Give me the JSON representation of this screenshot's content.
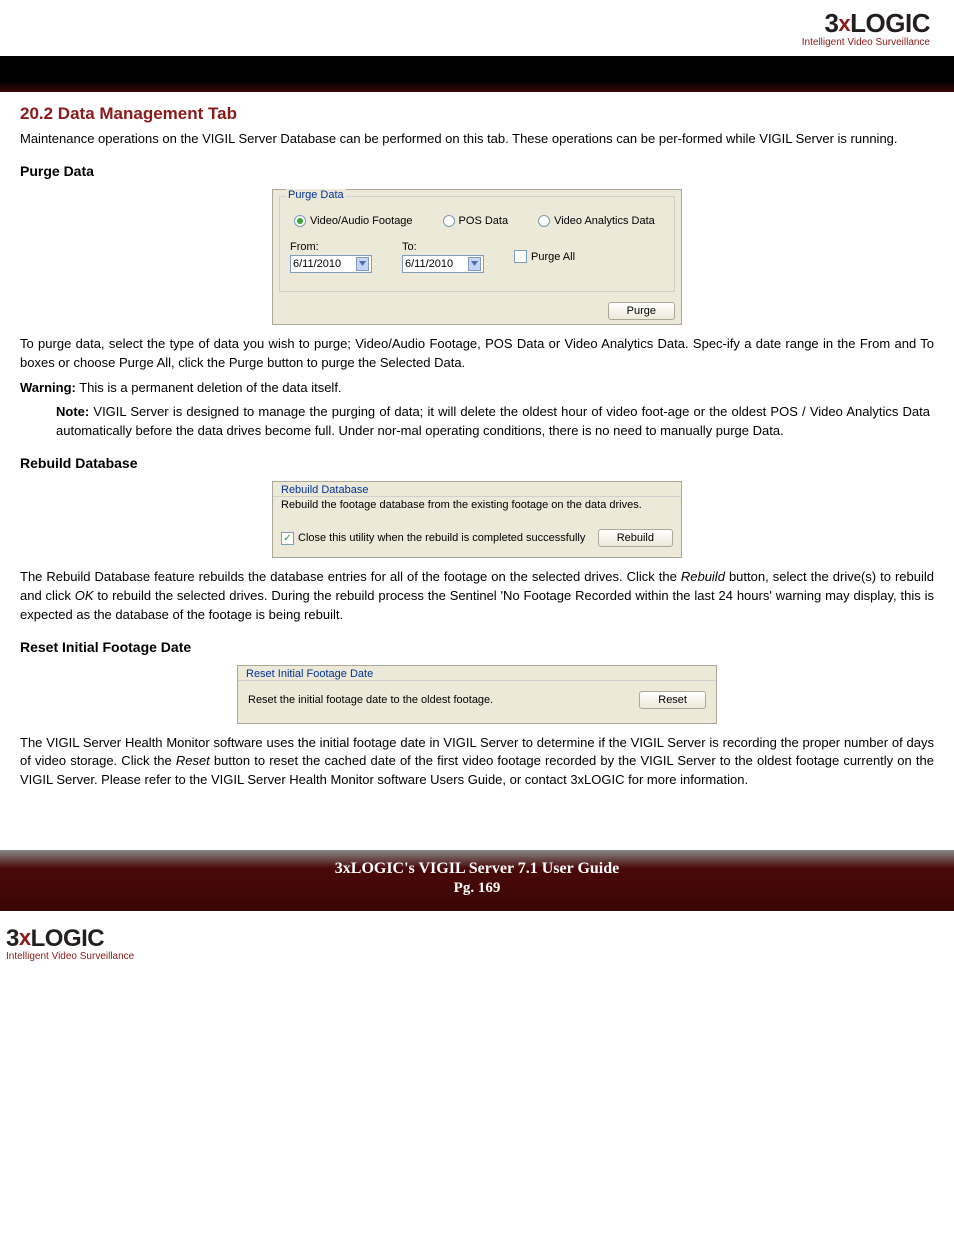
{
  "logo": {
    "brand_pre": "3",
    "brand_x": "x",
    "brand_post": "LOGIC",
    "tagline": "Intelligent Video Surveillance"
  },
  "h2": "20.2 Data Management Tab",
  "intro": "Maintenance operations on the VIGIL Server Database can be performed on this tab.  These operations can be per-formed while VIGIL Server is running.",
  "purge": {
    "heading": "Purge Data",
    "group_title": "Purge Data",
    "radio1": "Video/Audio Footage",
    "radio2": "POS Data",
    "radio3": "Video Analytics Data",
    "from_lbl": "From:",
    "to_lbl": "To:",
    "from_val": "6/11/2010",
    "to_val": "6/11/2010",
    "purge_all": "Purge All",
    "btn": "Purge",
    "para": "To purge data, select the type of data you wish to purge; Video/Audio Footage, POS Data or Video Analytics Data.  Spec-ify a date range in the From and To boxes or choose Purge All, click the Purge button to purge the Selected Data.",
    "warn_label": "Warning:",
    "warn": " This is a permanent deletion of the data itself.",
    "note_label": "Note:",
    "note": " VIGIL Server is designed to manage the purging of data; it will delete the oldest hour of video foot-age or the oldest POS / Video Analytics Data automatically before the data drives become full. Under nor-mal operating conditions, there is no need to manually purge Data."
  },
  "rebuild": {
    "heading": "Rebuild Database",
    "title": "Rebuild Database",
    "desc": "Rebuild the footage database from the existing footage on the data drives.",
    "chk": "Close this utility when the rebuild is completed successfully",
    "btn": "Rebuild",
    "para_a": "The Rebuild Database feature rebuilds the database entries for all of the footage on the selected drives. Click the ",
    "para_b": " button, select the drive(s) to rebuild and click ",
    "para_c": " to rebuild the selected drives.  During the rebuild process the Sentinel 'No Footage Recorded within the last 24 hours' warning may display, this is expected as the database of the footage is being rebuilt.",
    "rebuild_word": "Rebuild",
    "ok_word": "OK"
  },
  "reset": {
    "heading": "Reset Initial Footage Date",
    "title": "Reset Initial Footage Date",
    "desc": "Reset the initial footage date to the oldest footage.",
    "btn": "Reset",
    "para_a": "The VIGIL Server Health Monitor software uses the initial footage date in VIGIL Server to determine if the VIGIL Server is recording the proper number of days of video storage. Click the ",
    "para_b": " button to reset the cached date of the first video footage recorded by the VIGIL Server to the oldest footage currently on the VIGIL Server. Please refer to the VIGIL Server Health Monitor software Users Guide, or contact 3xLOGIC for more information.",
    "reset_word": "Reset"
  },
  "footer": {
    "title": "3xLOGIC's VIGIL Server 7.1 User Guide",
    "page": "Pg. 169"
  }
}
